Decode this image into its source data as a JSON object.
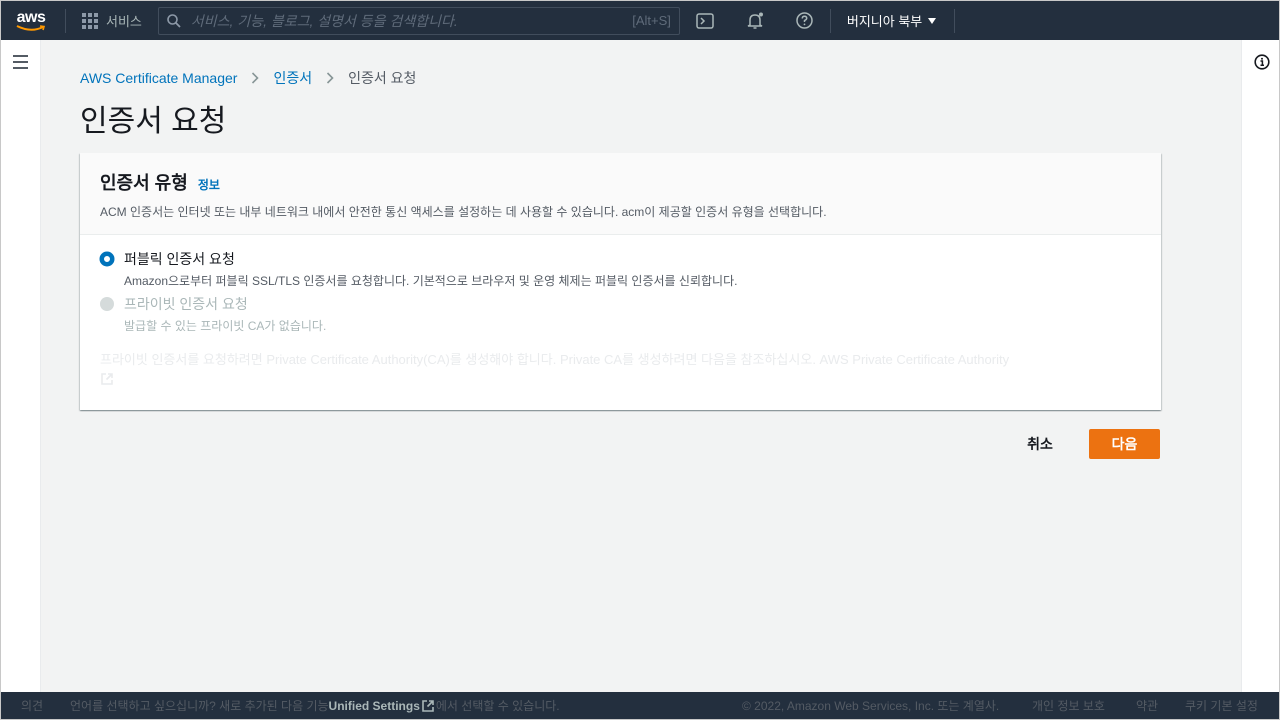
{
  "nav": {
    "logo": "aws",
    "services": "서비스",
    "search_placeholder": "서비스, 기능, 블로그, 설명서 등을 검색합니다.",
    "search_shortcut": "[Alt+S]",
    "region": "버지니아 북부"
  },
  "breadcrumb": {
    "service": "AWS Certificate Manager",
    "section": "인증서",
    "current": "인증서 요청"
  },
  "page_title": "인증서 요청",
  "panel": {
    "title": "인증서 유형",
    "info": "정보",
    "description": "ACM 인증서는 인터넷 또는 내부 네트워크 내에서 안전한 통신 액세스를 설정하는 데 사용할 수 있습니다. acm이 제공할 인증서 유형을 선택합니다.",
    "options": [
      {
        "label": "퍼블릭 인증서 요청",
        "description": "Amazon으로부터 퍼블릭 SSL/TLS 인증서를 요청합니다. 기본적으로 브라우저 및 운영 체제는 퍼블릭 인증서를 신뢰합니다.",
        "selected": true,
        "disabled": false
      },
      {
        "label": "프라이빗 인증서 요청",
        "description": "발급할 수 있는 프라이빗 CA가 없습니다.",
        "selected": false,
        "disabled": true
      }
    ],
    "notice": "프라이빗 인증서를 요청하려면 Private Certificate Authority(CA)를 생성해야 합니다. Private CA를 생성하려면 다음을 참조하십시오. AWS Private Certificate Authority"
  },
  "actions": {
    "cancel": "취소",
    "next": "다음"
  },
  "footer": {
    "feedback": "의견",
    "language_prompt": "언어를 선택하고 싶으십니까? 새로 추가된 다음 기능",
    "unified_settings": "Unified Settings",
    "language_suffix": "에서 선택할 수 있습니다.",
    "copyright": "© 2022, Amazon Web Services, Inc. 또는 계열사.",
    "privacy": "개인 정보 보호",
    "terms": "약관",
    "cookies": "쿠키 기본 설정"
  },
  "colors": {
    "nav_bg": "#232f3e",
    "link": "#0073bb",
    "primary_button": "#ec7211"
  }
}
